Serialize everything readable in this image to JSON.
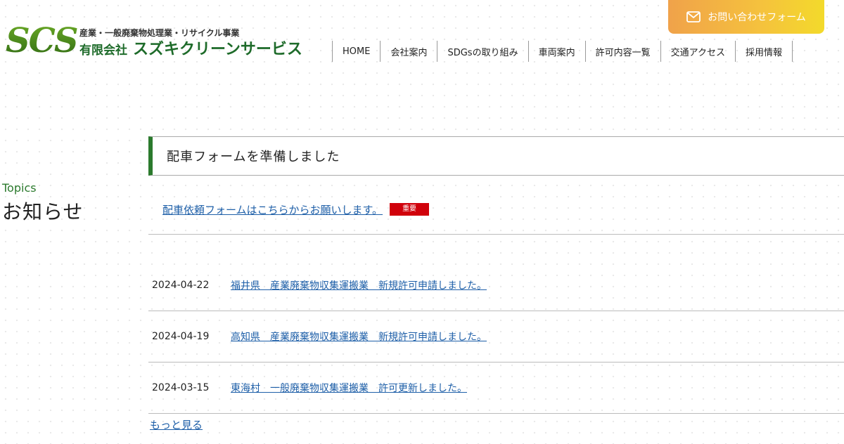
{
  "header": {
    "logo_mark": "SCS",
    "logo_sub": "産業・一般廃棄物処理業・リサイクル事業",
    "company_corp": "有限会社",
    "company_name": "スズキクリーンサービス",
    "contact_label": "お問い合わせフォーム",
    "nav": [
      {
        "label": "HOME"
      },
      {
        "label": "会社案内"
      },
      {
        "label": "SDGsの取り組み"
      },
      {
        "label": "車両案内"
      },
      {
        "label": "許可内容一覧"
      },
      {
        "label": "交通アクセス"
      },
      {
        "label": "採用情報"
      }
    ]
  },
  "section": {
    "label_en": "Topics",
    "label_jp": "お知らせ"
  },
  "notice": {
    "heading": "配車フォームを準備しました",
    "link_text": "配車依頼フォームはこちらからお願いします。",
    "badge": "重要"
  },
  "news": [
    {
      "date": "2024-04-22",
      "title": "福井県　産業廃棄物収集運搬業　新規許可申請しました。"
    },
    {
      "date": "2024-04-19",
      "title": "高知県　産業廃棄物収集運搬業　新規許可申請しました。"
    },
    {
      "date": "2024-03-15",
      "title": "東海村　一般廃棄物収集運搬業　許可更新しました。"
    }
  ],
  "more_link": "もっと見る"
}
